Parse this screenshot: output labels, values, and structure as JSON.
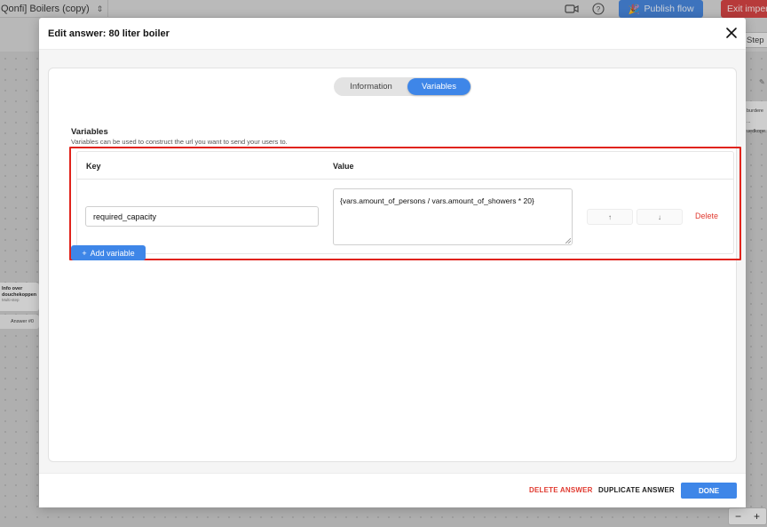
{
  "topbar": {
    "flow_title": "Qonfi] Boilers (copy)",
    "publish_label": "Publish flow",
    "exit_label": "Exit imper",
    "step_label": "Step"
  },
  "canvas": {
    "node_left_title": "Info over douchekoppen",
    "node_left_subtitle": "Multi-step",
    "node_left_answer": "Answer #0",
    "node_right_line1": "burdere ...",
    "node_right_line2": "uedkope..."
  },
  "modal": {
    "title": "Edit answer: 80 liter boiler",
    "tabs": [
      {
        "label": "Information",
        "active": false
      },
      {
        "label": "Variables",
        "active": true
      }
    ],
    "section_title": "Variables",
    "section_description": "Variables can be used to construct the url you want to send your users to.",
    "table": {
      "col_key": "Key",
      "col_value": "Value",
      "rows": [
        {
          "key": "required_capacity",
          "value": "{vars.amount_of_persons / vars.amount_of_showers * 20}",
          "move_up": "↑",
          "move_down": "↓",
          "delete_label": "Delete"
        }
      ]
    },
    "add_variable_label": "Add variable",
    "footer": {
      "delete_label": "DELETE ANSWER",
      "duplicate_label": "DUPLICATE ANSWER",
      "done_label": "DONE"
    }
  },
  "colors": {
    "accent": "#3e86e8",
    "danger": "#e03a30",
    "highlight": "#e0231b"
  }
}
